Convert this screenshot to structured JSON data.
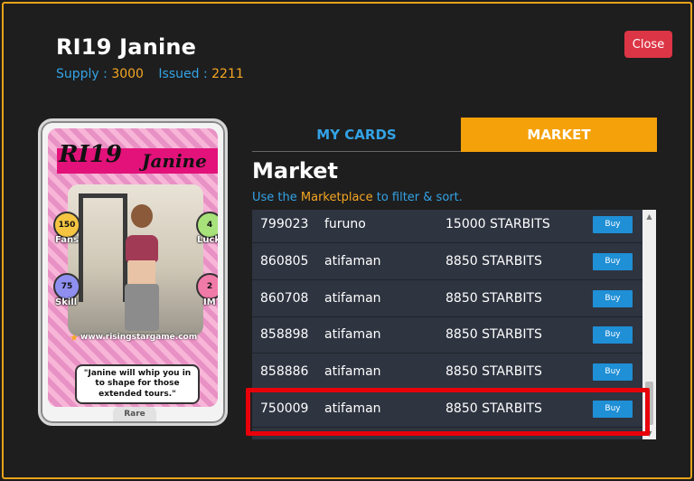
{
  "modal": {
    "title": "RI19 Janine",
    "supply_label": "Supply :",
    "supply_value": "3000",
    "issued_label": "Issued :",
    "issued_value": "2211",
    "close_label": "Close",
    "border_color": "#e8a21b"
  },
  "card": {
    "code": "RI19",
    "name": "Janine",
    "stats": {
      "fans_value": "150",
      "fans_label": "Fans",
      "luck_value": "4",
      "luck_label": "Luck",
      "skill_value": "75",
      "skill_label": "Skill",
      "im_value": "2",
      "im_label": "IM"
    },
    "website": "www.risingstargame.com",
    "quote": "\"Janine will whip you in to shape for those extended tours.\"",
    "rarity": "Rare",
    "accent_color": "#e2127a"
  },
  "tabs": {
    "my_cards": "MY CARDS",
    "market": "MARKET",
    "active": "market"
  },
  "market": {
    "title": "Market",
    "hint_prefix": "Use the",
    "hint_link": "Marketplace",
    "hint_suffix": "to filter & sort.",
    "buy_label": "Buy",
    "listings": [
      {
        "id": "799023",
        "seller": "furuno",
        "price": "15000 STARBITS"
      },
      {
        "id": "860805",
        "seller": "atifaman",
        "price": "8850 STARBITS"
      },
      {
        "id": "860708",
        "seller": "atifaman",
        "price": "8850 STARBITS"
      },
      {
        "id": "858898",
        "seller": "atifaman",
        "price": "8850 STARBITS"
      },
      {
        "id": "858886",
        "seller": "atifaman",
        "price": "8850 STARBITS"
      },
      {
        "id": "750009",
        "seller": "atifaman",
        "price": "8850 STARBITS"
      }
    ],
    "highlighted_id": "750009"
  },
  "colors": {
    "link_blue": "#33a3e6",
    "orange": "#f5a10a",
    "close_red": "#dc3545",
    "buy_blue": "#1f8fd6",
    "highlight_red": "#e8000b"
  }
}
